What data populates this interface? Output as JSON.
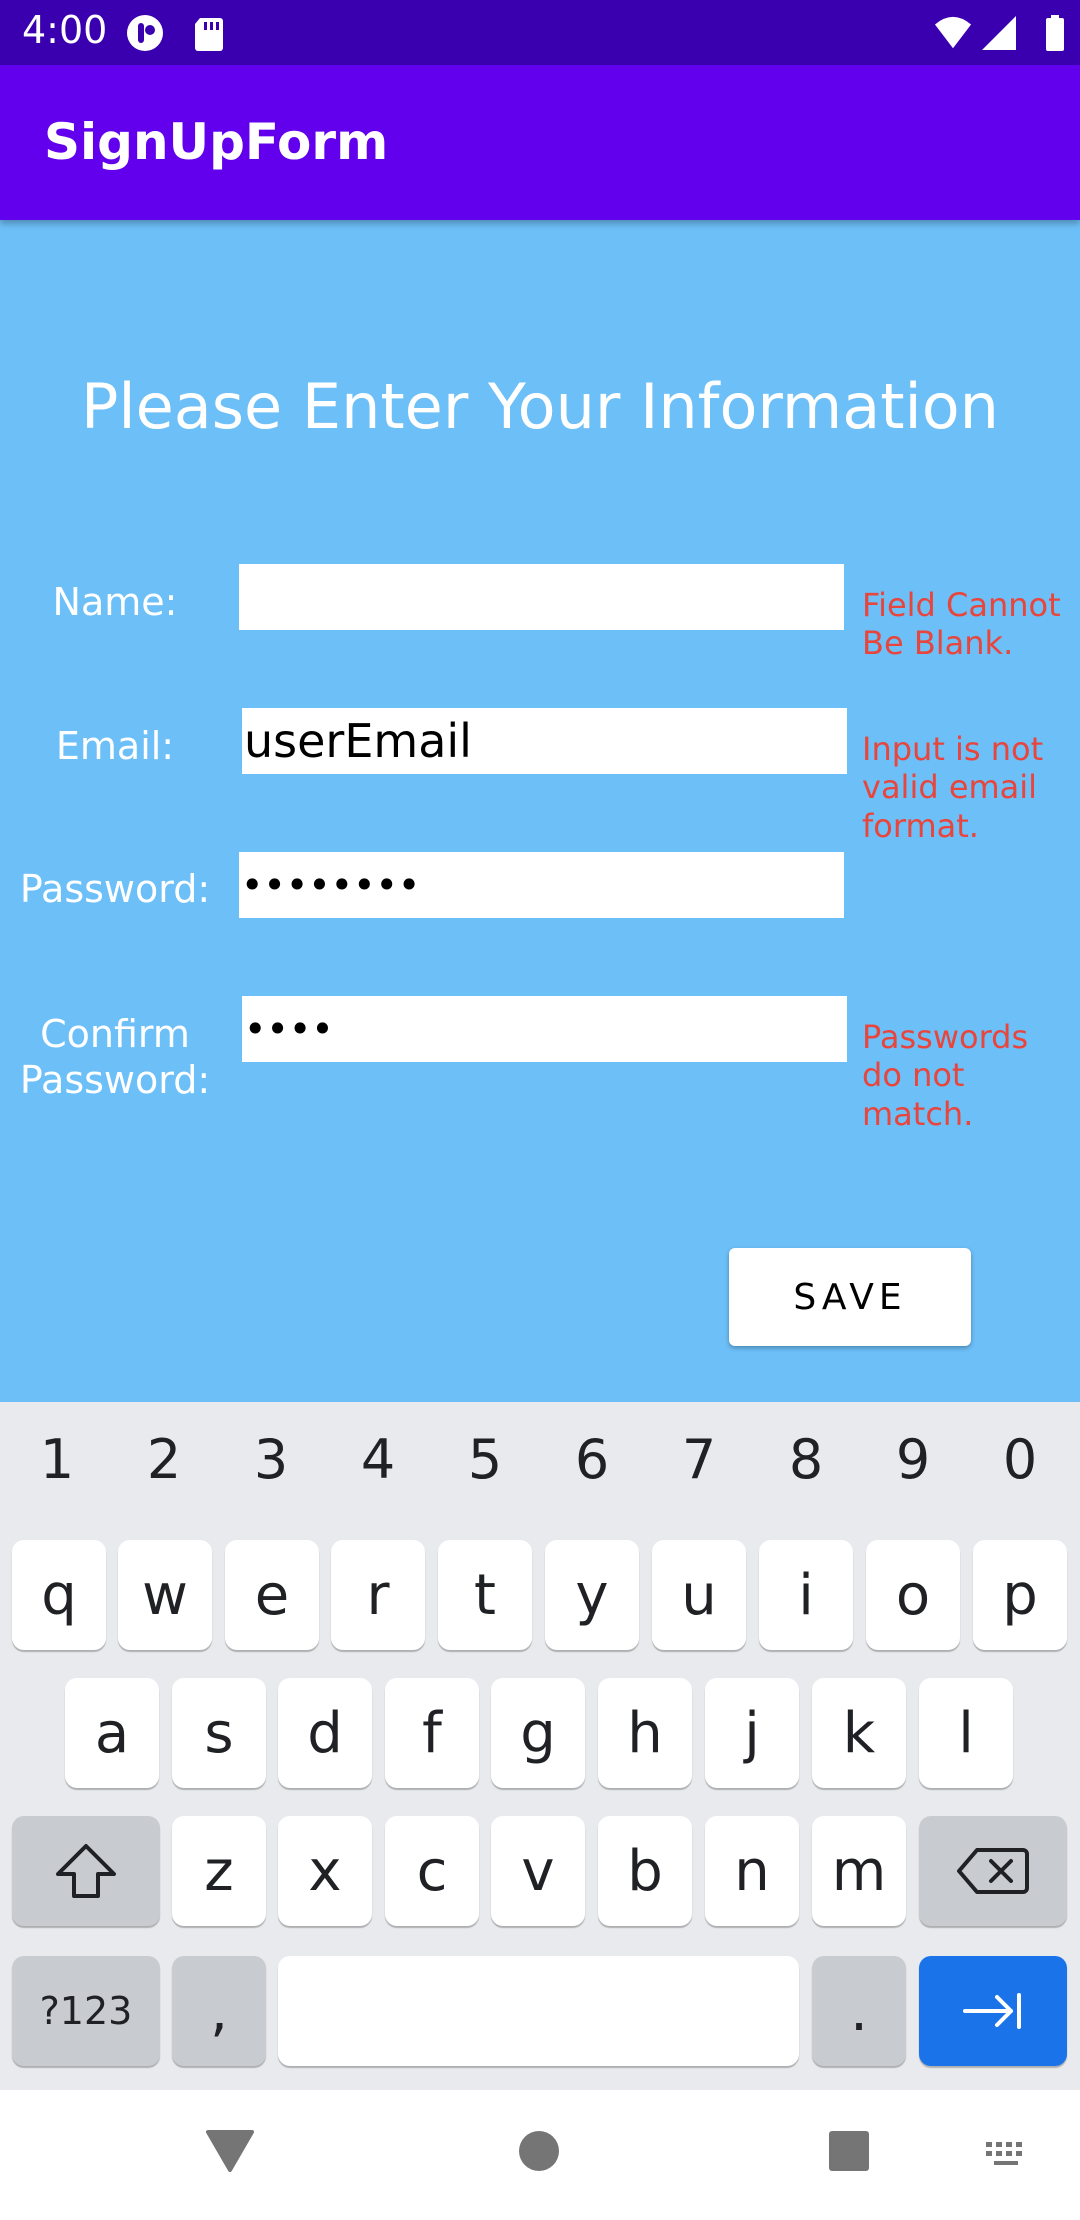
{
  "status_bar": {
    "time": "4:00"
  },
  "app_bar": {
    "title": "SignUpForm"
  },
  "form": {
    "heading": "Please Enter Your Information",
    "name": {
      "label": "Name:",
      "value": "",
      "error": "Field Cannot Be Blank."
    },
    "email": {
      "label": "Email:",
      "value": "userEmail",
      "error": "Input is not valid email format."
    },
    "password": {
      "label": "Password:",
      "value": "••••••••",
      "error": ""
    },
    "confirm_password": {
      "label": "Confirm Password:",
      "value": "••••",
      "error": "Passwords do not match."
    },
    "save_label": "SAVE"
  },
  "keyboard": {
    "numbers": [
      "1",
      "2",
      "3",
      "4",
      "5",
      "6",
      "7",
      "8",
      "9",
      "0"
    ],
    "row1": [
      "q",
      "w",
      "e",
      "r",
      "t",
      "y",
      "u",
      "i",
      "o",
      "p"
    ],
    "row2": [
      "a",
      "s",
      "d",
      "f",
      "g",
      "h",
      "j",
      "k",
      "l"
    ],
    "row3": [
      "z",
      "x",
      "c",
      "v",
      "b",
      "n",
      "m"
    ],
    "symbols_label": "?123",
    "comma": ",",
    "period": ".",
    "shift_icon": "shift-icon",
    "backspace_icon": "backspace-icon",
    "action_icon": "tab-arrow-icon"
  },
  "colors": {
    "status_bar": "#3a00b0",
    "app_bar": "#6200ee",
    "background": "#6dbff8",
    "error_text": "#e8453c",
    "action_key": "#1a73e8"
  }
}
